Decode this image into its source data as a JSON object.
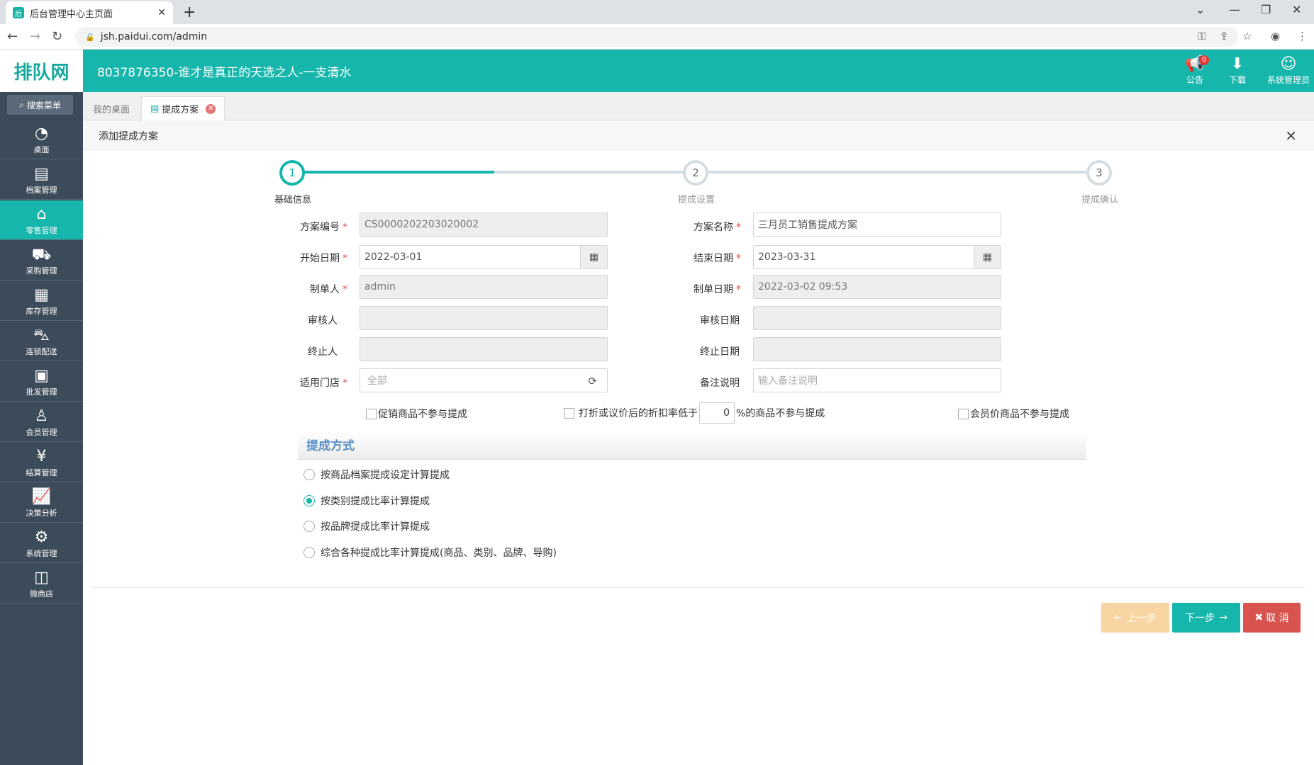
{
  "browser": {
    "tab_title": "后台管理中心主页面",
    "new_tab": "+",
    "url": "jsh.paidui.com/admin"
  },
  "header": {
    "logo": "排队网",
    "title": "8037876350-谁才是真正的天选之人-一支清水",
    "notice_label": "公告",
    "notice_badge": "0",
    "download_label": "下载",
    "user_label": "系统管理员"
  },
  "sidebar": {
    "search_label": "搜索菜单",
    "items": [
      {
        "label": "桌面",
        "icon": "dashboard-icon"
      },
      {
        "label": "档案管理",
        "icon": "archive-icon"
      },
      {
        "label": "零售管理",
        "icon": "store-icon"
      },
      {
        "label": "采购管理",
        "icon": "cart-icon"
      },
      {
        "label": "库存管理",
        "icon": "inventory-icon"
      },
      {
        "label": "连锁配送",
        "icon": "truck-icon"
      },
      {
        "label": "批发管理",
        "icon": "wholesale-icon"
      },
      {
        "label": "会员管理",
        "icon": "member-icon"
      },
      {
        "label": "结算管理",
        "icon": "settlement-icon"
      },
      {
        "label": "决策分析",
        "icon": "analysis-icon"
      },
      {
        "label": "系统管理",
        "icon": "gear-icon"
      },
      {
        "label": "微商店",
        "icon": "shop-icon"
      }
    ],
    "active_index": 2
  },
  "tabs": [
    {
      "label": "我的桌面"
    },
    {
      "label": "提成方案"
    }
  ],
  "panel": {
    "title": "添加提成方案",
    "close": "×"
  },
  "steps": [
    {
      "num": "1",
      "label": "基础信息"
    },
    {
      "num": "2",
      "label": "提成设置"
    },
    {
      "num": "3",
      "label": "提成确认"
    }
  ],
  "form": {
    "plan_no_label": "方案编号",
    "plan_no_value": "CS0000202203020002",
    "plan_name_label": "方案名称",
    "plan_name_value": "三月员工销售提成方案",
    "start_date_label": "开始日期",
    "start_date_value": "2022-03-01",
    "end_date_label": "结束日期",
    "end_date_value": "2023-03-31",
    "creator_label": "制单人",
    "creator_value": "admin",
    "create_date_label": "制单日期",
    "create_date_value": "2022-03-02 09:53",
    "auditor_label": "审核人",
    "audit_date_label": "审核日期",
    "terminator_label": "终止人",
    "terminate_date_label": "终止日期",
    "store_label": "适用门店",
    "store_value": "全部",
    "remark_label": "备注说明",
    "remark_placeholder": "输入备注说明",
    "required_mark": "*"
  },
  "options": {
    "promo_exclude": "促销商品不参与提成",
    "discount_prefix": "打折或议价后的折扣率低于",
    "discount_value": "0",
    "discount_suffix": "%的商品不参与提成",
    "member_price_exclude": "会员价商品不参与提成"
  },
  "commission": {
    "section_title": "提成方式",
    "methods": [
      "按商品档案提成设定计算提成",
      "按类别提成比率计算提成",
      "按品牌提成比率计算提成",
      "综合各种提成比率计算提成(商品、类别、品牌、导购)"
    ],
    "selected_index": 1
  },
  "buttons": {
    "prev": "上一步",
    "next": "下一步",
    "cancel": "取 消"
  },
  "colors": {
    "brand": "#17b6ac",
    "sidebar": "#3c4b5a",
    "danger": "#d9534f",
    "section_title": "#5b8fc6"
  }
}
